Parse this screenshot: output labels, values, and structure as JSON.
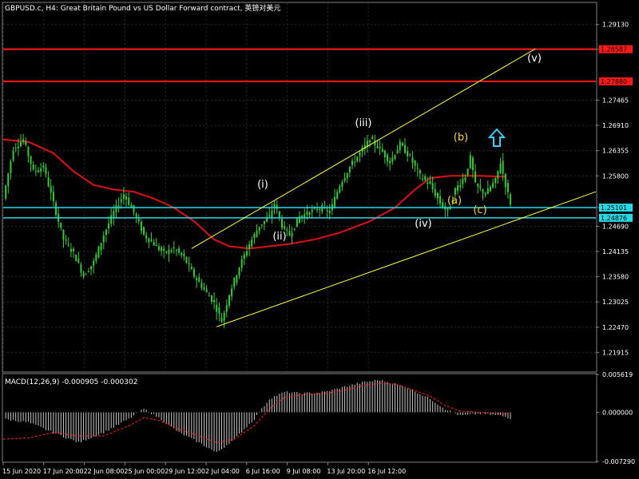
{
  "header": {
    "title": "GBPUSD.c, H4:  Great Britain Pound vs US Dollar Forward contract, 英镑对美元"
  },
  "colors": {
    "background": "#000000",
    "grid": "#2a2a2a",
    "candle": "#33cc33",
    "ma_line": "#e01010",
    "h_line_red": "#ff1a1a",
    "h_line_cyan": "#26d9e6",
    "channel": "#ffff33",
    "wave_white": "#ffffff",
    "wave_yellow": "#ffd633",
    "arrow_cyan": "#33ccff",
    "macd_hist": "#c8c8c8",
    "macd_signal": "#ff1a1a"
  },
  "price_axis": {
    "ticks": [
      "1.29130",
      "1.28587",
      "1.27465",
      "1.26910",
      "1.26355",
      "1.25800",
      "1.25101",
      "1.24690",
      "1.24135",
      "1.23580",
      "1.23025",
      "1.22470",
      "1.21915"
    ],
    "min": 1.215,
    "max": 1.296
  },
  "level_labels": [
    {
      "name": "upper-red",
      "value": 1.28587,
      "label": "1.28587",
      "color": "#ff1a1a"
    },
    {
      "name": "lower-red",
      "value": 1.2788,
      "label": "1.27880",
      "color": "#ff1a1a"
    },
    {
      "name": "upper-cyan",
      "value": 1.25101,
      "label": "1.25101",
      "color": "#26d9e6"
    },
    {
      "name": "lower-cyan",
      "value": 1.24876,
      "label": "1.24876",
      "color": "#26d9e6"
    }
  ],
  "time_axis": {
    "labels": [
      "15 Jun 2020",
      "17 Jun 20:00",
      "22 Jun 08:00",
      "25 Jun 00:00",
      "29 Jun 12:00",
      "2 Jul 04:00",
      "6 Jul 16:00",
      "9 Jul 08:00",
      "13 Jul 20:00",
      "16 Jul 12:00"
    ]
  },
  "wave_labels": [
    {
      "text": "(i)",
      "color": "white"
    },
    {
      "text": "(ii)",
      "color": "white"
    },
    {
      "text": "(iii)",
      "color": "white"
    },
    {
      "text": "(iv)",
      "color": "white"
    },
    {
      "text": "(v)",
      "color": "white"
    },
    {
      "text": "(a)",
      "color": "yellow"
    },
    {
      "text": "(b)",
      "color": "yellow"
    },
    {
      "text": "(c)",
      "color": "yellow"
    }
  ],
  "macd": {
    "label": "MACD(12,26,9) -0.000905 -0.000302",
    "ticks": [
      "0.005619",
      "0.000000",
      "-0.007290"
    ],
    "min": -0.00729,
    "max": 0.005619
  },
  "chart_data": {
    "type": "candlestick",
    "title": "GBPUSD.c, H4:  Great Britain Pound vs US Dollar Forward contract, 英镑对美元",
    "ylim": [
      1.215,
      1.296
    ],
    "close_path": [
      [
        0,
        1.253
      ],
      [
        4,
        1.264
      ],
      [
        8,
        1.266
      ],
      [
        12,
        1.259
      ],
      [
        16,
        1.26
      ],
      [
        20,
        1.252
      ],
      [
        24,
        1.244
      ],
      [
        28,
        1.241
      ],
      [
        32,
        1.236
      ],
      [
        36,
        1.239
      ],
      [
        40,
        1.245
      ],
      [
        44,
        1.25
      ],
      [
        48,
        1.254
      ],
      [
        52,
        1.25
      ],
      [
        56,
        1.245
      ],
      [
        60,
        1.243
      ],
      [
        64,
        1.241
      ],
      [
        68,
        1.242
      ],
      [
        72,
        1.24
      ],
      [
        76,
        1.236
      ],
      [
        80,
        1.233
      ],
      [
        84,
        1.23
      ],
      [
        87,
        1.226
      ],
      [
        90,
        1.232
      ],
      [
        94,
        1.238
      ],
      [
        98,
        1.243
      ],
      [
        102,
        1.247
      ],
      [
        106,
        1.249
      ],
      [
        108,
        1.252
      ],
      [
        111,
        1.247
      ],
      [
        114,
        1.245
      ],
      [
        118,
        1.249
      ],
      [
        122,
        1.25
      ],
      [
        126,
        1.251
      ],
      [
        130,
        1.25
      ],
      [
        134,
        1.256
      ],
      [
        138,
        1.26
      ],
      [
        142,
        1.263
      ],
      [
        146,
        1.266
      ],
      [
        150,
        1.264
      ],
      [
        154,
        1.261
      ],
      [
        158,
        1.265
      ],
      [
        162,
        1.262
      ],
      [
        166,
        1.258
      ],
      [
        170,
        1.256
      ],
      [
        174,
        1.252
      ],
      [
        177,
        1.25
      ],
      [
        180,
        1.255
      ],
      [
        184,
        1.258
      ],
      [
        186,
        1.262
      ],
      [
        188,
        1.256
      ],
      [
        192,
        1.254
      ],
      [
        196,
        1.257
      ],
      [
        198,
        1.261
      ],
      [
        200,
        1.256
      ],
      [
        202,
        1.252
      ]
    ],
    "ma_path": [
      [
        0,
        1.266
      ],
      [
        10,
        1.2655
      ],
      [
        20,
        1.263
      ],
      [
        28,
        1.259
      ],
      [
        36,
        1.256
      ],
      [
        44,
        1.255
      ],
      [
        52,
        1.2545
      ],
      [
        60,
        1.253
      ],
      [
        68,
        1.251
      ],
      [
        76,
        1.248
      ],
      [
        84,
        1.244
      ],
      [
        90,
        1.2425
      ],
      [
        98,
        1.242
      ],
      [
        106,
        1.2425
      ],
      [
        114,
        1.243
      ],
      [
        124,
        1.244
      ],
      [
        134,
        1.2455
      ],
      [
        146,
        1.248
      ],
      [
        156,
        1.251
      ],
      [
        164,
        1.255
      ],
      [
        170,
        1.2575
      ],
      [
        178,
        1.258
      ],
      [
        190,
        1.258
      ],
      [
        200,
        1.2578
      ]
    ],
    "channel_upper": [
      [
        75,
        1.242
      ],
      [
        212,
        1.286
      ]
    ],
    "channel_lower": [
      [
        85,
        1.2248
      ],
      [
        236,
        1.2545
      ]
    ],
    "macd_hist": [
      [
        0,
        -0.001
      ],
      [
        10,
        -0.0015
      ],
      [
        20,
        -0.003
      ],
      [
        30,
        -0.0045
      ],
      [
        40,
        -0.003
      ],
      [
        50,
        -0.001
      ],
      [
        56,
        0.0005
      ],
      [
        62,
        -0.0008
      ],
      [
        70,
        -0.003
      ],
      [
        78,
        -0.0045
      ],
      [
        85,
        -0.006
      ],
      [
        92,
        -0.004
      ],
      [
        100,
        -0.001
      ],
      [
        106,
        0.002
      ],
      [
        112,
        0.003
      ],
      [
        120,
        0.0028
      ],
      [
        128,
        0.003
      ],
      [
        136,
        0.0038
      ],
      [
        144,
        0.0045
      ],
      [
        150,
        0.0048
      ],
      [
        156,
        0.0042
      ],
      [
        162,
        0.0035
      ],
      [
        170,
        0.002
      ],
      [
        176,
        0.0005
      ],
      [
        182,
        -0.0005
      ],
      [
        190,
        -0.0002
      ],
      [
        198,
        -0.0005
      ],
      [
        202,
        -0.0009
      ]
    ],
    "macd_signal": [
      [
        0,
        -0.004
      ],
      [
        10,
        -0.0038
      ],
      [
        20,
        -0.003
      ],
      [
        30,
        -0.0035
      ],
      [
        40,
        -0.0035
      ],
      [
        50,
        -0.002
      ],
      [
        56,
        -0.0008
      ],
      [
        62,
        -0.0012
      ],
      [
        70,
        -0.0025
      ],
      [
        78,
        -0.0035
      ],
      [
        85,
        -0.0045
      ],
      [
        92,
        -0.004
      ],
      [
        100,
        -0.002
      ],
      [
        106,
        0.0005
      ],
      [
        112,
        0.0022
      ],
      [
        120,
        0.0026
      ],
      [
        128,
        0.0028
      ],
      [
        136,
        0.0033
      ],
      [
        144,
        0.004
      ],
      [
        150,
        0.0043
      ],
      [
        156,
        0.0042
      ],
      [
        162,
        0.0035
      ],
      [
        170,
        0.0024
      ],
      [
        176,
        0.001
      ],
      [
        182,
        0.0002
      ],
      [
        190,
        0.0
      ],
      [
        198,
        -0.0002
      ],
      [
        202,
        -0.0003
      ]
    ]
  }
}
